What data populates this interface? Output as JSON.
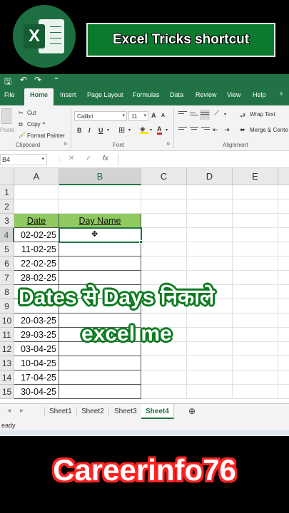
{
  "banner": {
    "title": "Excel Tricks shortcut",
    "logo_letter": "X",
    "logo_icon": "excel-logo-icon"
  },
  "excel": {
    "qat": {
      "save_icon": "🖫",
      "undo_icon": "↶",
      "redo_icon": "↷",
      "customize_icon": "⁼"
    },
    "tabs": [
      "File",
      "Home",
      "Insert",
      "Page Layout",
      "Formulas",
      "Data",
      "Review",
      "View",
      "Help"
    ],
    "active_tab": "Home",
    "tell_me_icon": "♀",
    "ribbon": {
      "paste_label": "Paste",
      "cut_label": "Cut",
      "copy_label": "Copy",
      "format_painter_label": "Format Painter",
      "clipboard_group": "Clipboard",
      "font_name": "Calibri",
      "font_size": "11",
      "grow_font": "A",
      "shrink_font": "A",
      "bold": "B",
      "italic": "I",
      "underline": "U",
      "font_group": "Font",
      "wrap_text": "Wrap Text",
      "merge_center": "Merge & Cente",
      "alignment_group": "Alignment"
    },
    "formula_bar": {
      "name_box": "B4",
      "cancel": "✕",
      "enter": "✓",
      "fx": "fx",
      "value": ""
    },
    "columns": [
      "A",
      "B",
      "C",
      "D",
      "E"
    ],
    "rows": [
      "1",
      "2",
      "3",
      "4",
      "5",
      "6",
      "7",
      "8",
      "9",
      "10",
      "11",
      "12",
      "13",
      "14",
      "15"
    ],
    "selected_cell": "B4",
    "header_date": "Date",
    "header_day": "Day Name",
    "dates": [
      "02-02-25",
      "11-02-25",
      "22-02-25",
      "28-02-25",
      "",
      "",
      "20-03-25",
      "29-03-25",
      "03-04-25",
      "10-04-25",
      "17-04-25",
      "30-04-25"
    ],
    "sheets": [
      "Sheet1",
      "Sheet2",
      "Sheet3",
      "Sheet4"
    ],
    "active_sheet": "Sheet4",
    "add_sheet": "⊕",
    "status": "eady"
  },
  "overlay": {
    "line1": "Dates से Days निकाले",
    "line2": "excel me"
  },
  "footer": {
    "brand": "Careerinfo76"
  },
  "colors": {
    "excel_green": "#217346",
    "header_fill": "#8fc95f",
    "overlay_outline": "#0b7a1f",
    "brand_outline": "#ff2222"
  }
}
